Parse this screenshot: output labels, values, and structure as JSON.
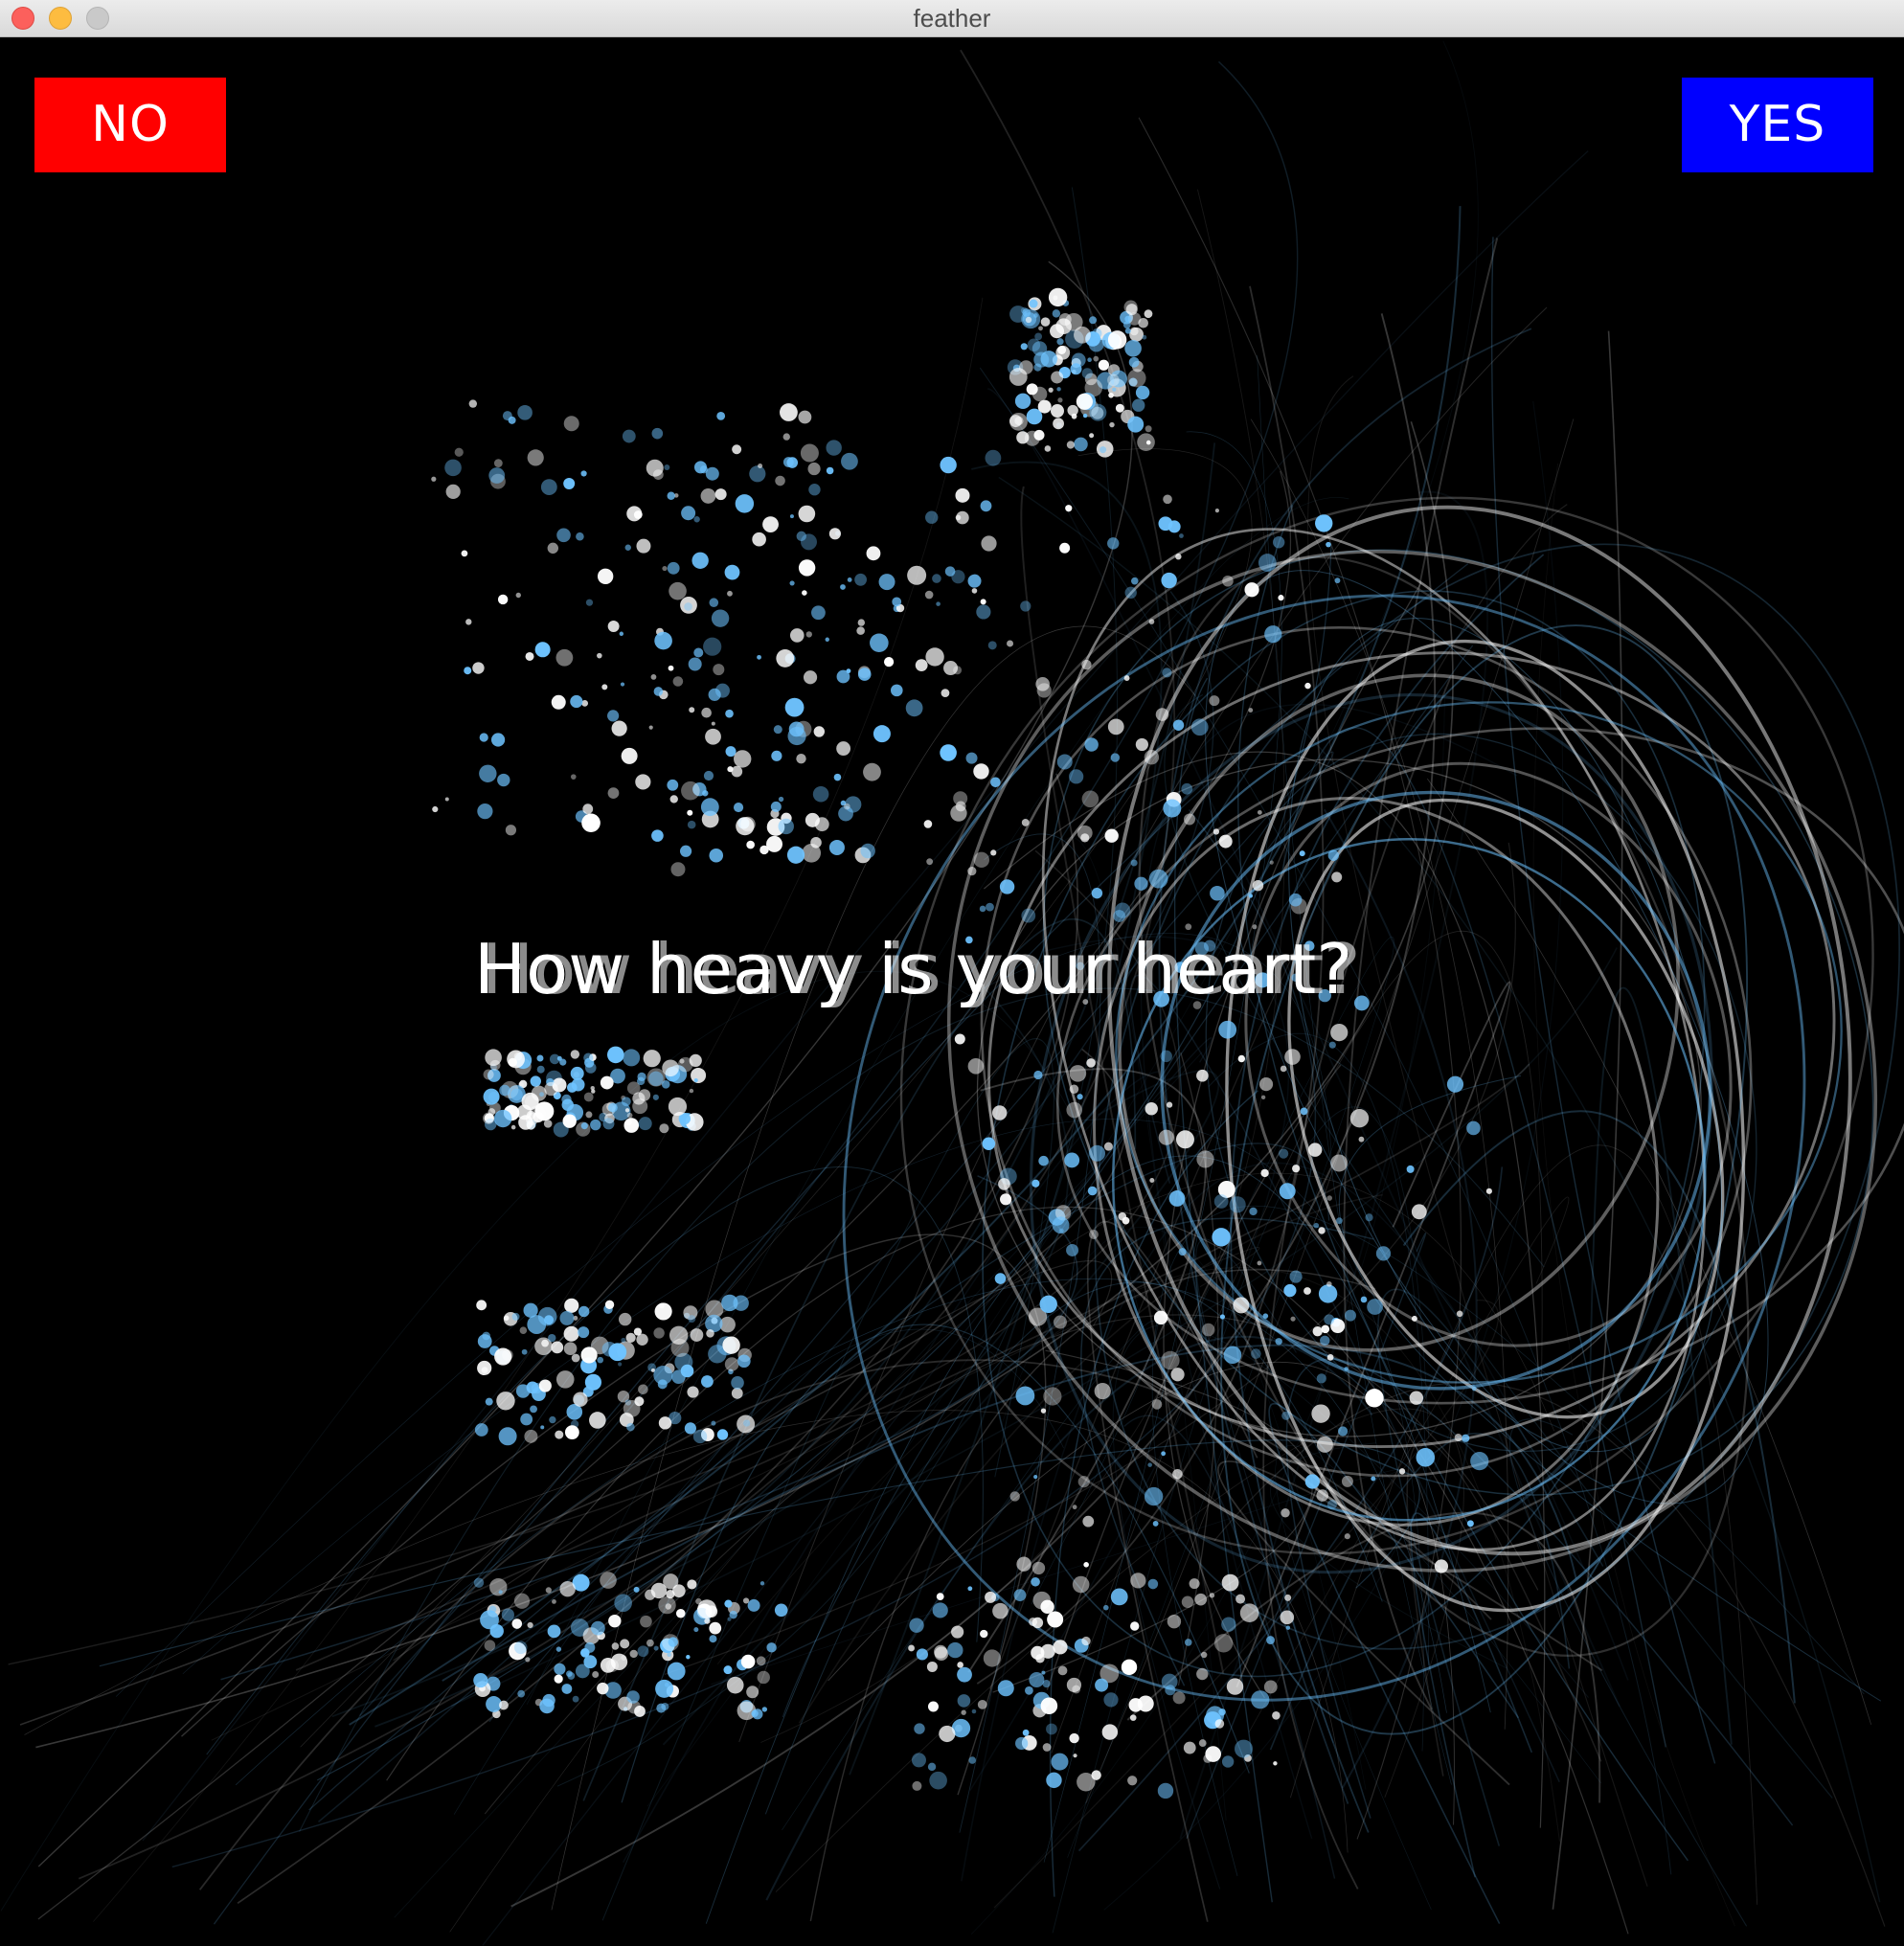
{
  "window": {
    "title": "feather"
  },
  "buttons": {
    "no_label": "NO",
    "yes_label": "YES",
    "no_color": "#ff0000",
    "yes_color": "#0000ff"
  },
  "question": {
    "text": "How heavy is your heart?"
  },
  "colors": {
    "background": "#000000",
    "particle_light": "#ffffff",
    "particle_blue": "#6ec3ff",
    "particle_deep_blue": "#2e7fd6"
  }
}
